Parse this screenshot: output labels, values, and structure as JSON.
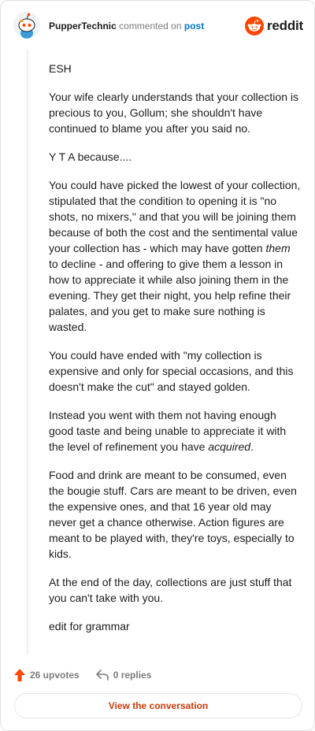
{
  "comment": {
    "username": "PupperTechnic",
    "action_text": "commented on",
    "post_link": "post"
  },
  "brand": {
    "name": "reddit",
    "color": "#ff4500"
  },
  "body": {
    "p1": "ESH",
    "p2": "Your wife clearly understands that your collection is precious to you, Gollum; she shouldn't have continued to blame you after you said no.",
    "p3": "Y T A because....",
    "p4_before": "You could have picked the lowest of your collection, stipulated that the condition to opening it is \"no shots, no mixers,\" and that you will be joining them because of both the cost and the sentimental value your collection has - which may have gotten ",
    "p4_em": "them",
    "p4_after": " to decline - and offering to give them a lesson in how to appreciate it while also joining them in the evening. They get their night, you help refine their palates, and you get to make sure nothing is wasted.",
    "p5": "You could have ended with \"my collection is expensive and only for special occasions, and this doesn't make the cut\" and stayed golden.",
    "p6_before": "Instead you went with them not having enough good taste and being unable to appreciate it with the level of refinement you have ",
    "p6_em": "acquired",
    "p6_after": ".",
    "p7": "Food and drink are meant to be consumed, even the bougie stuff. Cars are meant to be driven, even the expensive ones, and that 16 year old may never get a chance otherwise. Action figures are meant to be played with, they're toys, especially to kids.",
    "p8": "At the end of the day, collections are just stuff that you can't take with you.",
    "p9": "edit for grammar"
  },
  "actions": {
    "upvotes": "26 upvotes",
    "replies": "0 replies",
    "upvote_color": "#ff4500"
  },
  "view_conversation": "View the conversation",
  "icons": {
    "avatar": "snoo-avatar-icon",
    "upvote": "upvote-arrow-icon",
    "reply": "reply-arrow-icon",
    "brand": "reddit-logo-icon"
  }
}
